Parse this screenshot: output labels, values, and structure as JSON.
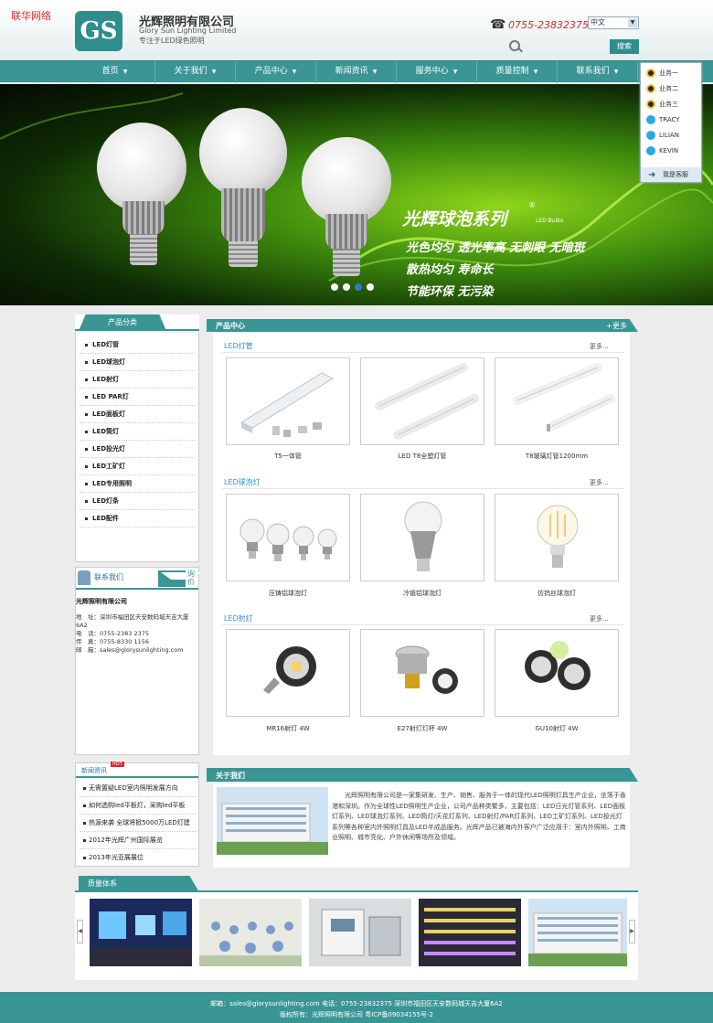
{
  "header": {
    "site_tag": "联华网络",
    "logo_text": "GS",
    "company_name": "光辉照明有限公司",
    "company_en": "Glory Sun Lighting Limited",
    "slogan": "专注于LED绿色照明",
    "phone": "0755-23832375",
    "language": "中文",
    "search_placeholder": "",
    "search_button": "搜索"
  },
  "nav": [
    "首页",
    "关于我们",
    "产品中心",
    "新闻资讯",
    "服务中心",
    "质量控制",
    "联系我们"
  ],
  "banner": {
    "title": "光辉球泡系列",
    "reg": "®",
    "sub": "LED Bulbs",
    "lines": [
      "光色均匀 透光率高 无刺眼 无暗斑",
      "散热均匀 寿命长",
      "节能环保 无污染"
    ],
    "slides": 4,
    "active_slide": 3
  },
  "service": {
    "items": [
      {
        "type": "qq",
        "label": "业务一"
      },
      {
        "type": "qq",
        "label": "业务二"
      },
      {
        "type": "qq",
        "label": "业务三"
      },
      {
        "type": "skype",
        "label": "TRACY"
      },
      {
        "type": "skype",
        "label": "LILIAN"
      },
      {
        "type": "skype",
        "label": "KEVIN"
      }
    ],
    "footer": "我是客服"
  },
  "sidebar": {
    "title": "产品分类",
    "categories": [
      "LED灯管",
      "LED球泡灯",
      "LED射灯",
      "LED PAR灯",
      "LED面板灯",
      "LED筒灯",
      "LED投光灯",
      "LED工矿灯",
      "LED专用照明",
      "LED灯条",
      "LED配件"
    ]
  },
  "contact": {
    "title": "联系我们",
    "ask": "询价",
    "company": "光辉照明有限公司",
    "address_label": "地　址：",
    "address": "深圳市福田区天安数码城天吉大厦6A2",
    "phone_label": "电　话：",
    "phone": "0755-2383 2375",
    "fax_label": "传　真：",
    "fax": "0755-8330 1156",
    "email_label": "邮　箱：",
    "email": "sales@glorysunlighting.com"
  },
  "news": {
    "title": "新闻资讯",
    "hot": "HOT",
    "items": [
      "无需置疑LED室内照明发展方向",
      "如何选购led平板灯，采购led平板",
      "热源来袭 全球将掀5000万LED灯建",
      "2012年光辉广州国际展览",
      "2013年光亚展展位"
    ]
  },
  "products": {
    "title": "产品中心",
    "more": "+更多",
    "sections": [
      {
        "title": "LED灯管",
        "more": "更多...",
        "items": [
          "T5一体管",
          "LED T8全塑灯管",
          "T8玻璃灯管1200mm"
        ]
      },
      {
        "title": "LED球泡灯",
        "more": "更多...",
        "items": [
          "压铸铝球泡灯",
          "冷锻铝球泡灯",
          "仿钨丝球泡灯"
        ]
      },
      {
        "title": "LED射灯",
        "more": "更多...",
        "items": [
          "MR16射灯 4W",
          "E27射灯灯杯 4W",
          "GU10射灯 4W"
        ]
      }
    ]
  },
  "about": {
    "title": "关于我们",
    "text": "光辉照明有限公司是一家集研发、生产、销售、服务于一体的现代LED照明灯具生产企业，坐落于香港和深圳。作为全球性LED照明生产企业，公司产品种类繁多，主要包括：LED日光灯管系列、LED面板灯系列、LED球泡灯系列、LED筒灯/天花灯系列、LED射灯/PAR灯系列、LED工矿灯系列、LED投光灯系列等各种室内外照明灯具及LED半成品服务。光辉产品已被海内外客户广泛应用于：室内外照明、工商业照明、城市亮化、户外休闲等场所及领域。"
  },
  "quality": {
    "title": "质量体系"
  },
  "footer": {
    "line1": "邮箱：sales@glorysunlighting.com 电话：0755-23832375 深圳市福田区天安数码城天吉大厦6A2",
    "line2": "版权所有：光辉照明有限公司 粤ICP备09034155号-2"
  },
  "colors": {
    "teal": "#3a9595",
    "red": "#e0282e",
    "link_blue": "#2f8fd0"
  }
}
